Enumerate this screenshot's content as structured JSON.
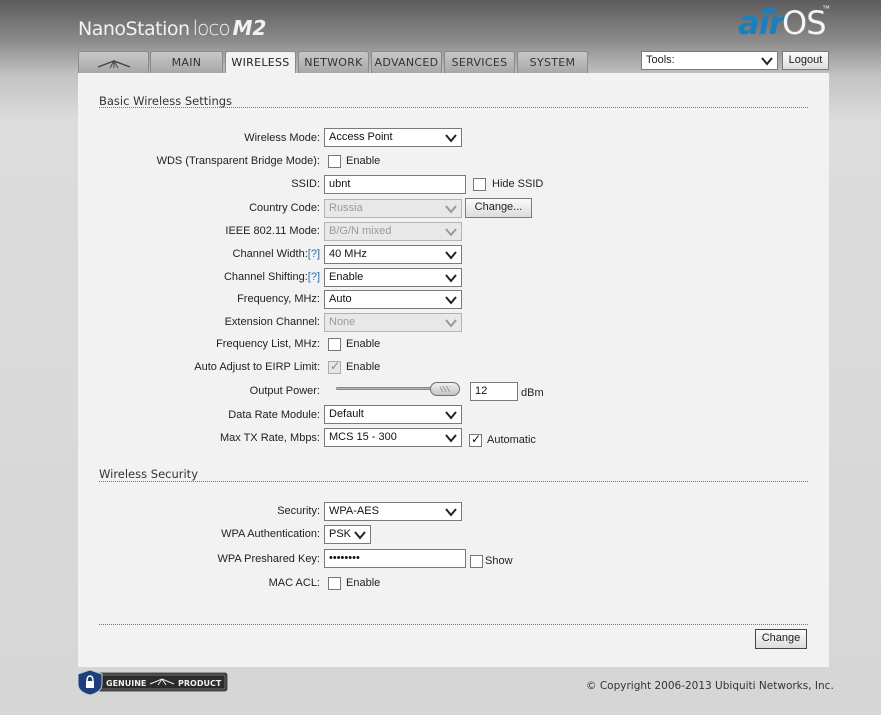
{
  "header": {
    "product_name": "NanoStation",
    "product_line": "loco",
    "product_model": "M2",
    "brand_air": "air",
    "brand_os": "OS",
    "brand_tm": "™",
    "tools_value": "Tools:",
    "logout_label": "Logout"
  },
  "tabs": [
    {
      "label": "",
      "icon": "ubiquiti-logo-icon"
    },
    {
      "label": "MAIN"
    },
    {
      "label": "WIRELESS",
      "active": true
    },
    {
      "label": "NETWORK"
    },
    {
      "label": "ADVANCED"
    },
    {
      "label": "SERVICES"
    },
    {
      "label": "SYSTEM"
    }
  ],
  "basic": {
    "title": "Basic Wireless Settings",
    "wireless_mode_label": "Wireless Mode:",
    "wireless_mode_value": "Access Point",
    "wds_label": "WDS (Transparent Bridge Mode):",
    "wds_enable": "Enable",
    "ssid_label": "SSID:",
    "ssid_value": "ubnt",
    "hide_ssid": "Hide SSID",
    "country_label": "Country Code:",
    "country_value": "Russia",
    "country_change": "Change...",
    "ieee_label": "IEEE 802.11 Mode:",
    "ieee_value": "B/G/N mixed",
    "channel_width_label": "Channel Width:",
    "channel_width_help": "[?]",
    "channel_width_value": "40 MHz",
    "channel_shifting_label": "Channel Shifting:",
    "channel_shifting_help": "[?]",
    "channel_shifting_value": "Enable",
    "frequency_label": "Frequency, MHz:",
    "frequency_value": "Auto",
    "extension_label": "Extension Channel:",
    "extension_value": "None",
    "freq_list_label": "Frequency List, MHz:",
    "freq_list_enable": "Enable",
    "eirp_label": "Auto Adjust to EIRP Limit:",
    "eirp_enable": "Enable",
    "output_power_label": "Output Power:",
    "output_power_value": "12",
    "output_power_unit": "dBm",
    "data_rate_label": "Data Rate Module:",
    "data_rate_value": "Default",
    "max_tx_label": "Max TX Rate, Mbps:",
    "max_tx_value": "MCS 15 - 300",
    "max_tx_auto": "Automatic"
  },
  "security": {
    "title": "Wireless Security",
    "security_label": "Security:",
    "security_value": "WPA-AES",
    "wpa_auth_label": "WPA Authentication:",
    "wpa_auth_value": "PSK",
    "psk_label": "WPA Preshared Key:",
    "psk_value": "••••••••",
    "psk_show": "Show",
    "mac_acl_label": "MAC ACL:",
    "mac_acl_enable": "Enable"
  },
  "footer": {
    "change_label": "Change",
    "genuine_text_left": "GENUINE",
    "genuine_text_right": "PRODUCT",
    "copyright": "© Copyright 2006-2013 Ubiquiti Networks, Inc."
  },
  "colors": {
    "accent": "#1a7fc1",
    "help_link": "#2a6db0"
  }
}
